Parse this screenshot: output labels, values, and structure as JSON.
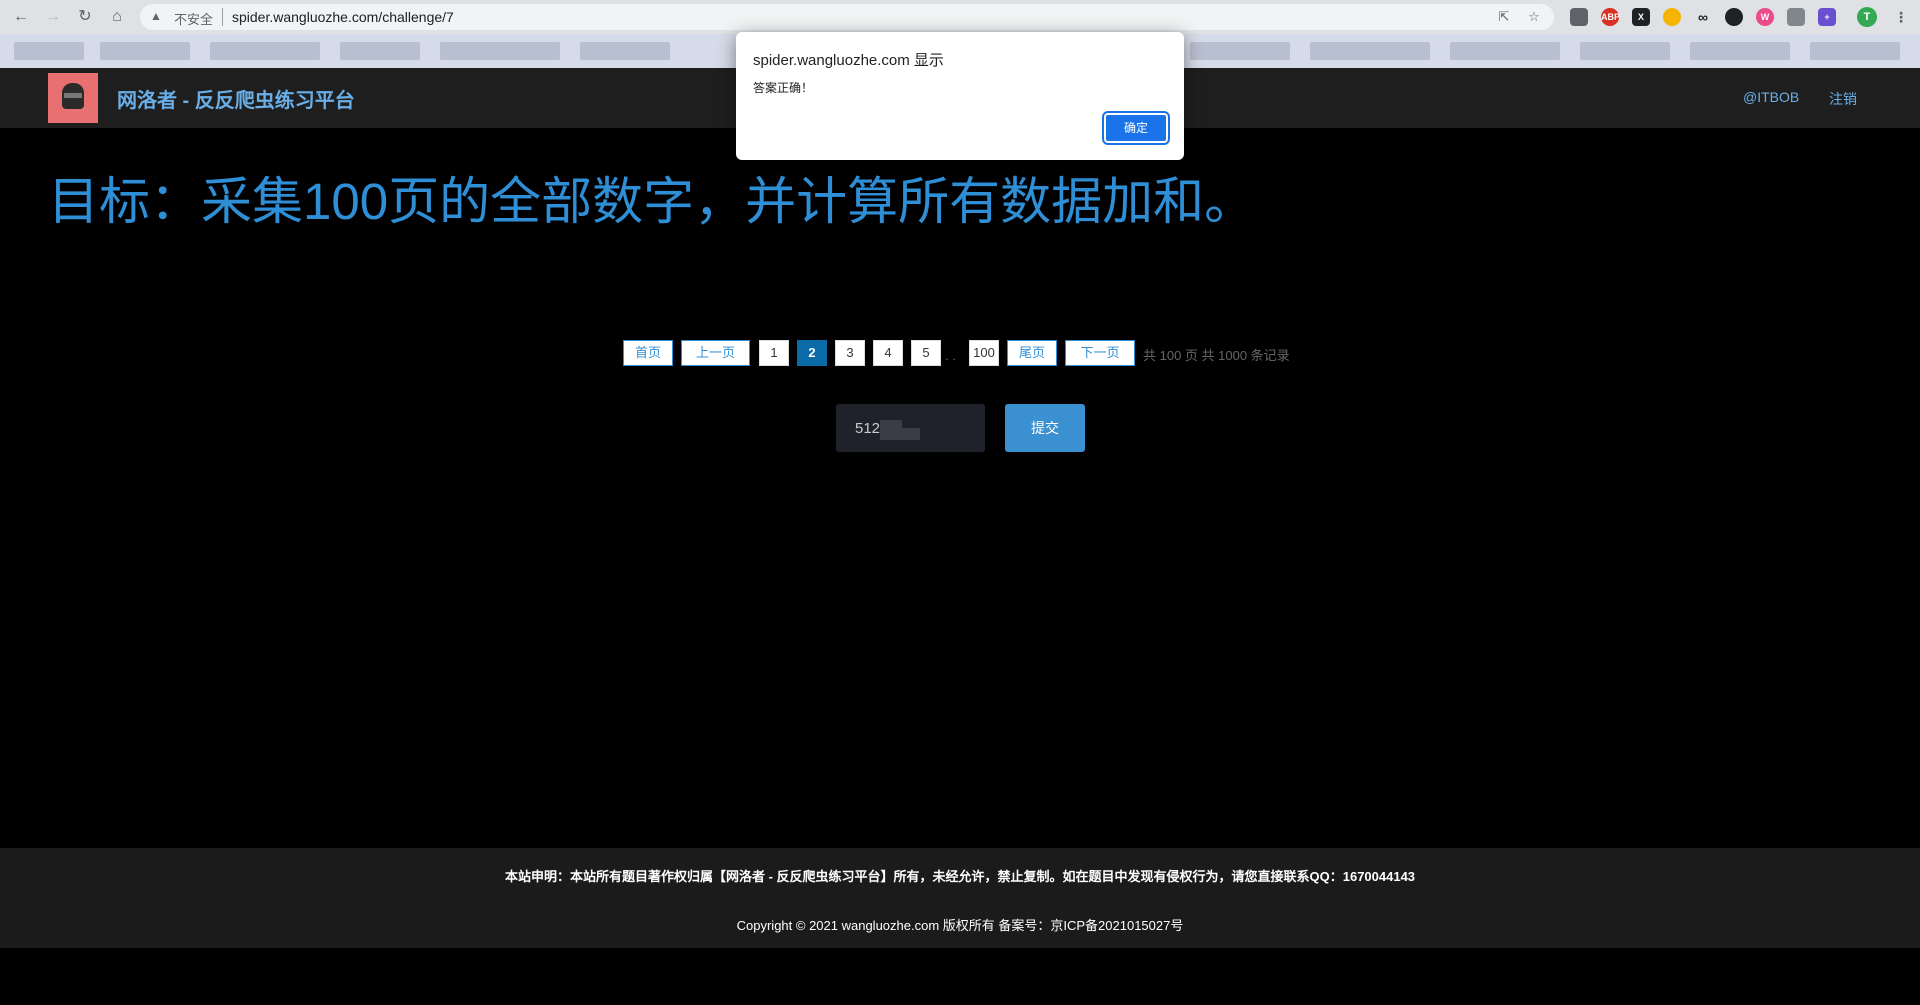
{
  "browser": {
    "security_label": "不安全",
    "url": "spider.wangluozhe.com/challenge/7",
    "profile_initial": "T",
    "extensions": [
      "ABP",
      "X",
      "∞",
      "W",
      "+",
      "⧉"
    ]
  },
  "site": {
    "title": "网洛者 - 反反爬虫练习平台",
    "user_link": "@ITBOB",
    "logout_link": "注销"
  },
  "goal": "目标：采集100页的全部数字，并计算所有数据加和。",
  "pagination": {
    "first": "首页",
    "prev": "上一页",
    "pages": [
      "1",
      "2",
      "3",
      "4",
      "5"
    ],
    "current": "2",
    "ellipsis": ". .",
    "last_page": "100",
    "last": "尾页",
    "next": "下一页",
    "summary": "共 100 页 共 1000 条记录"
  },
  "answer": {
    "value": "512",
    "submit": "提交"
  },
  "footer": {
    "notice": "本站申明：本站所有题目著作权归属【网洛者 - 反反爬虫练习平台】所有，未经允许，禁止复制。如在题目中发现有侵权行为，请您直接联系QQ：1670044143",
    "copyright": "Copyright © 2021 wangluozhe.com 版权所有 备案号：京ICP备2021015027号"
  },
  "dialog": {
    "title": "spider.wangluozhe.com 显示",
    "message": "答案正确！",
    "ok": "确定"
  }
}
